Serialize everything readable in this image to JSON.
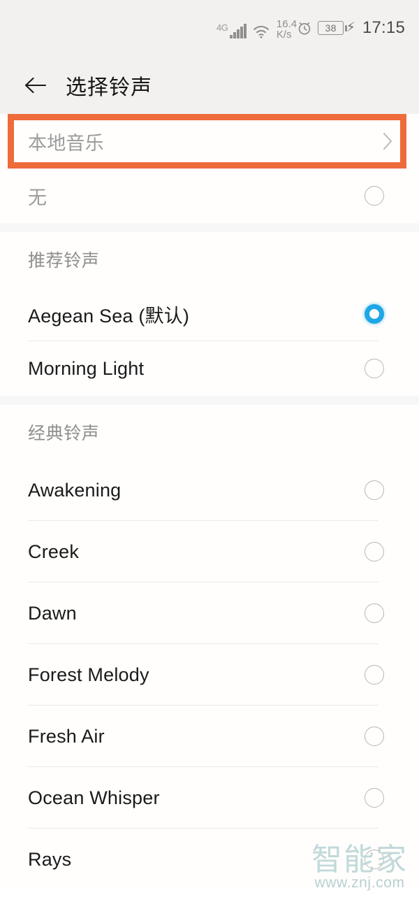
{
  "theme": {
    "accent_blue": "#1fa6e6",
    "highlight_orange": "#ee6b3b",
    "bar_background": "#f2f1ef",
    "row_background": "#fffefc",
    "separator": "#f7f7f7"
  },
  "status_bar": {
    "network_type": "4G",
    "signal_icon": "signal-bars-icon",
    "wifi_icon": "wifi-icon",
    "net_speed_value": "16.4",
    "net_speed_unit": "K/s",
    "alarm_icon": "alarm-clock-icon",
    "battery_percent": "38",
    "charging_icon": "charging-bolt-icon",
    "time": "17:15"
  },
  "app_bar": {
    "back_icon": "back-arrow-icon",
    "title": "选择铃声"
  },
  "annotation": {
    "shape": "rectangle-outline",
    "color": "#ee6b3b",
    "targets": "local-music-row"
  },
  "local_music": {
    "label": "本地音乐",
    "chevron_icon": "chevron-right-icon"
  },
  "sections": [
    {
      "header": null,
      "items": [
        {
          "label": "无",
          "selected": false,
          "muted": true
        }
      ]
    },
    {
      "header": "推荐铃声",
      "items": [
        {
          "label": "Aegean Sea (默认)",
          "selected": true,
          "muted": false
        },
        {
          "label": "Morning Light",
          "selected": false,
          "muted": false
        }
      ]
    },
    {
      "header": "经典铃声",
      "items": [
        {
          "label": "Awakening",
          "selected": false,
          "muted": false
        },
        {
          "label": "Creek",
          "selected": false,
          "muted": false
        },
        {
          "label": "Dawn",
          "selected": false,
          "muted": false
        },
        {
          "label": "Forest Melody",
          "selected": false,
          "muted": false
        },
        {
          "label": "Fresh Air",
          "selected": false,
          "muted": false
        },
        {
          "label": "Ocean Whisper",
          "selected": false,
          "muted": false
        },
        {
          "label": "Rays",
          "selected": false,
          "muted": false
        }
      ]
    }
  ],
  "watermark": {
    "brand": "智能家",
    "url": "www.znj.com"
  }
}
